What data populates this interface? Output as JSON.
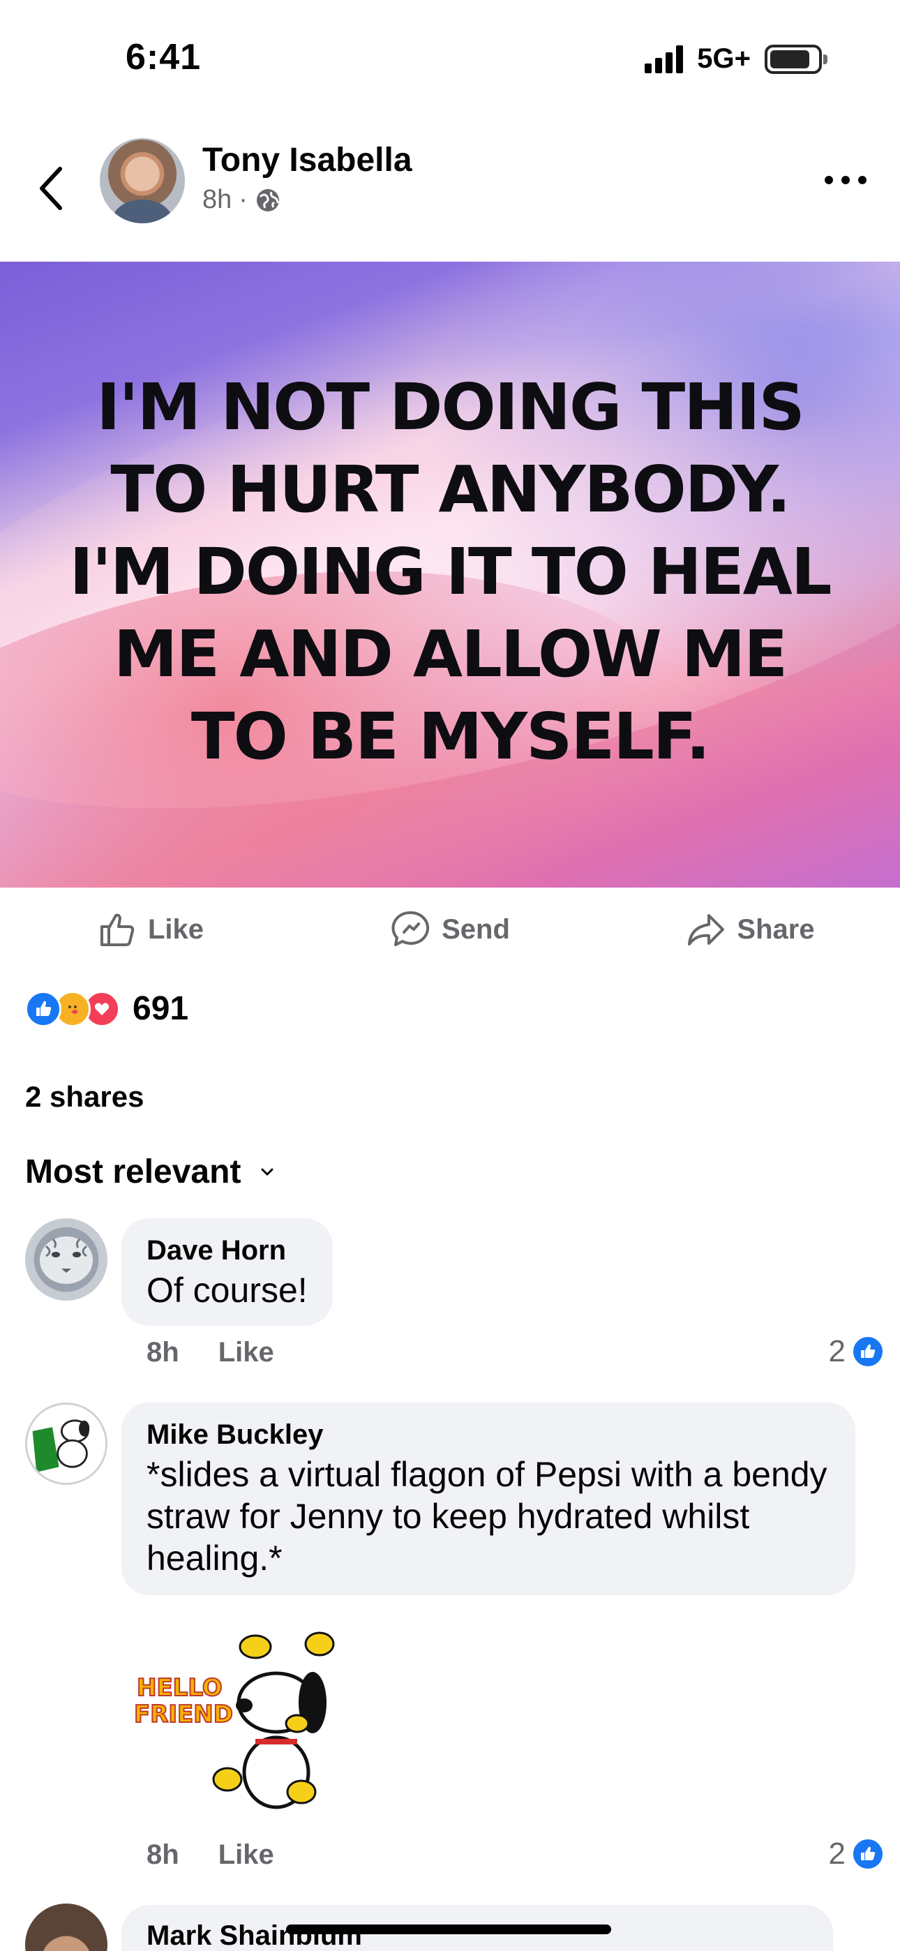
{
  "status_bar": {
    "time": "6:41",
    "network": "5G+"
  },
  "post": {
    "author": "Tony Isabella",
    "time": "8h",
    "separator": "·",
    "image_text": "I'M NOT DOING THIS TO HURT ANYBODY. I'M DOING IT TO HEAL ME AND ALLOW ME TO BE MYSELF.",
    "image_lines": [
      "I'M NOT DOING THIS",
      "TO HURT ANYBODY.",
      "I'M DOING IT TO HEAL",
      "ME AND ALLOW ME",
      "TO BE MYSELF."
    ]
  },
  "actions": {
    "like": "Like",
    "send": "Send",
    "share": "Share"
  },
  "reactions": {
    "count": "691",
    "types": [
      "like",
      "care",
      "love"
    ]
  },
  "shares": "2 shares",
  "sort": "Most relevant",
  "comments": [
    {
      "name": "Dave Horn",
      "text": "Of course!",
      "time": "8h",
      "like_label": "Like",
      "likes": "2"
    },
    {
      "name": "Mike Buckley",
      "text": "*slides a virtual flagon of Pepsi with a bendy straw  for Jenny to keep hydrated whilst healing.*",
      "time": "8h",
      "like_label": "Like",
      "likes": "2",
      "sticker_text": [
        "HELLO",
        "FRIEND"
      ]
    },
    {
      "name": "Mark Shainblum"
    }
  ],
  "colors": {
    "accent": "#1877f2",
    "meta": "#65676b",
    "bubble": "#f0f2f5"
  }
}
